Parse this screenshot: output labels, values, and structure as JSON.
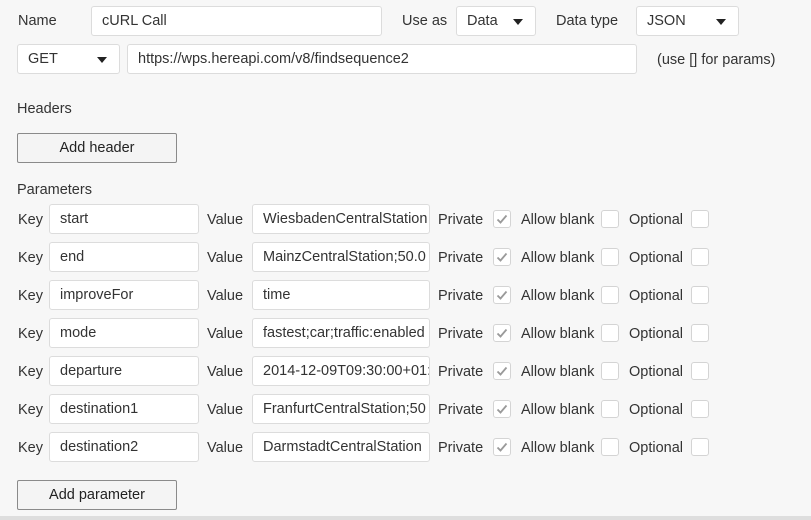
{
  "top": {
    "name_label": "Name",
    "name_value": "cURL Call",
    "use_as_label": "Use as",
    "use_as_value": "Data",
    "data_type_label": "Data type",
    "data_type_value": "JSON"
  },
  "request": {
    "method": "GET",
    "url": "https://wps.hereapi.com/v8/findsequence2",
    "hint": "(use [] for params)"
  },
  "headers": {
    "title": "Headers",
    "add_label": "Add header"
  },
  "parameters": {
    "title": "Parameters",
    "key_label": "Key",
    "value_label": "Value",
    "private_label": "Private",
    "allow_blank_label": "Allow blank",
    "optional_label": "Optional",
    "add_label": "Add parameter",
    "rows": [
      {
        "key": "start",
        "value": "WiesbadenCentralStation",
        "private": true,
        "allow_blank": false,
        "optional": false
      },
      {
        "key": "end",
        "value": "MainzCentralStation;50.0",
        "private": true,
        "allow_blank": false,
        "optional": false
      },
      {
        "key": "improveFor",
        "value": "time",
        "private": true,
        "allow_blank": false,
        "optional": false
      },
      {
        "key": "mode",
        "value": "fastest;car;traffic:enabled",
        "private": true,
        "allow_blank": false,
        "optional": false
      },
      {
        "key": "departure",
        "value": "2014-12-09T09:30:00+01:",
        "private": true,
        "allow_blank": false,
        "optional": false
      },
      {
        "key": "destination1",
        "value": "FranfurtCentralStation;50",
        "private": true,
        "allow_blank": false,
        "optional": false
      },
      {
        "key": "destination2",
        "value": "DarmstadtCentralStation",
        "private": true,
        "allow_blank": false,
        "optional": false
      }
    ]
  }
}
